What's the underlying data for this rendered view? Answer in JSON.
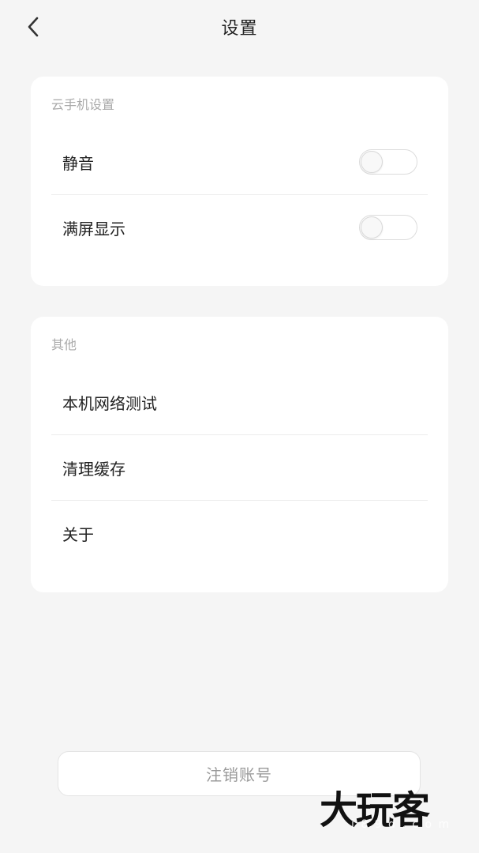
{
  "header": {
    "title": "设置",
    "back_icon": "chevron-left-icon"
  },
  "cloud_settings": {
    "title": "云手机设置",
    "items": [
      {
        "label": "静音",
        "toggle_on": false
      },
      {
        "label": "满屏显示",
        "toggle_on": false
      }
    ]
  },
  "other": {
    "title": "其他",
    "items": [
      {
        "label": "本机网络测试"
      },
      {
        "label": "清理缓存"
      },
      {
        "label": "关于"
      }
    ]
  },
  "logout": {
    "label": "注销账号"
  },
  "watermark": {
    "text": "大玩客",
    "sub": "i 8 9 d . c o m"
  },
  "colors": {
    "background": "#f5f5f5",
    "card": "#ffffff",
    "section_title": "#a9a9a9",
    "logout_text": "#9a9a9a"
  }
}
